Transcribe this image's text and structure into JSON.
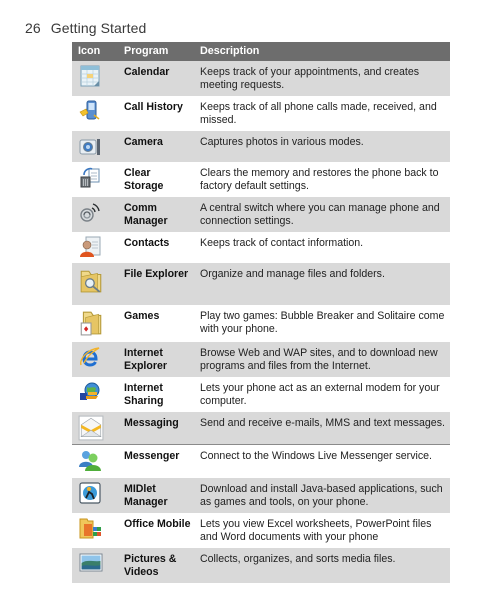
{
  "page": {
    "number": "26",
    "section": "Getting Started"
  },
  "table": {
    "headers": {
      "icon": "Icon",
      "program": "Program",
      "description": "Description"
    },
    "rows": [
      {
        "icon": "calendar-icon",
        "program": "Calendar",
        "description": "Keeps track of your appointments, and creates meeting requests."
      },
      {
        "icon": "call-history-icon",
        "program": "Call History",
        "description": "Keeps track of all phone calls made, received, and missed."
      },
      {
        "icon": "camera-icon",
        "program": "Camera",
        "description": "Captures photos in various modes."
      },
      {
        "icon": "clear-storage-icon",
        "program": "Clear Storage",
        "description": "Clears the memory and restores the phone back to factory default settings."
      },
      {
        "icon": "comm-manager-icon",
        "program": "Comm Manager",
        "description": "A central switch where you can manage phone and connection settings."
      },
      {
        "icon": "contacts-icon",
        "program": "Contacts",
        "description": "Keeps track of contact information."
      },
      {
        "icon": "file-explorer-icon",
        "program": "File Explorer",
        "description": "Organize and manage files and folders."
      },
      {
        "icon": "games-icon",
        "program": "Games",
        "description": "Play two games: Bubble Breaker and Solitaire come with your phone."
      },
      {
        "icon": "internet-explorer-icon",
        "program": "Internet Explorer",
        "description": "Browse Web and WAP sites, and to download new programs and files from the Internet."
      },
      {
        "icon": "internet-sharing-icon",
        "program": "Internet Sharing",
        "description": "Lets your phone act as an external modem for your computer."
      },
      {
        "icon": "messaging-icon",
        "program": "Messaging",
        "description": "Send and receive e-mails, MMS and text messages."
      },
      {
        "icon": "messenger-icon",
        "program": "Messenger",
        "description": "Connect to the Windows Live Messenger service."
      },
      {
        "icon": "midlet-manager-icon",
        "program": "MIDlet Manager",
        "description": "Download and install Java-based applications, such as games and tools, on your phone."
      },
      {
        "icon": "office-mobile-icon",
        "program": "Office Mobile",
        "description": "Lets you view Excel worksheets, PowerPoint files and Word documents with your phone"
      },
      {
        "icon": "pictures-videos-icon",
        "program": "Pictures & Videos",
        "description": "Collects, organizes, and sorts media files."
      }
    ]
  },
  "colors": {
    "header_bg": "#6d6d6d",
    "shaded_row": "#d9d9d9",
    "plain_row": "#ffffff"
  }
}
